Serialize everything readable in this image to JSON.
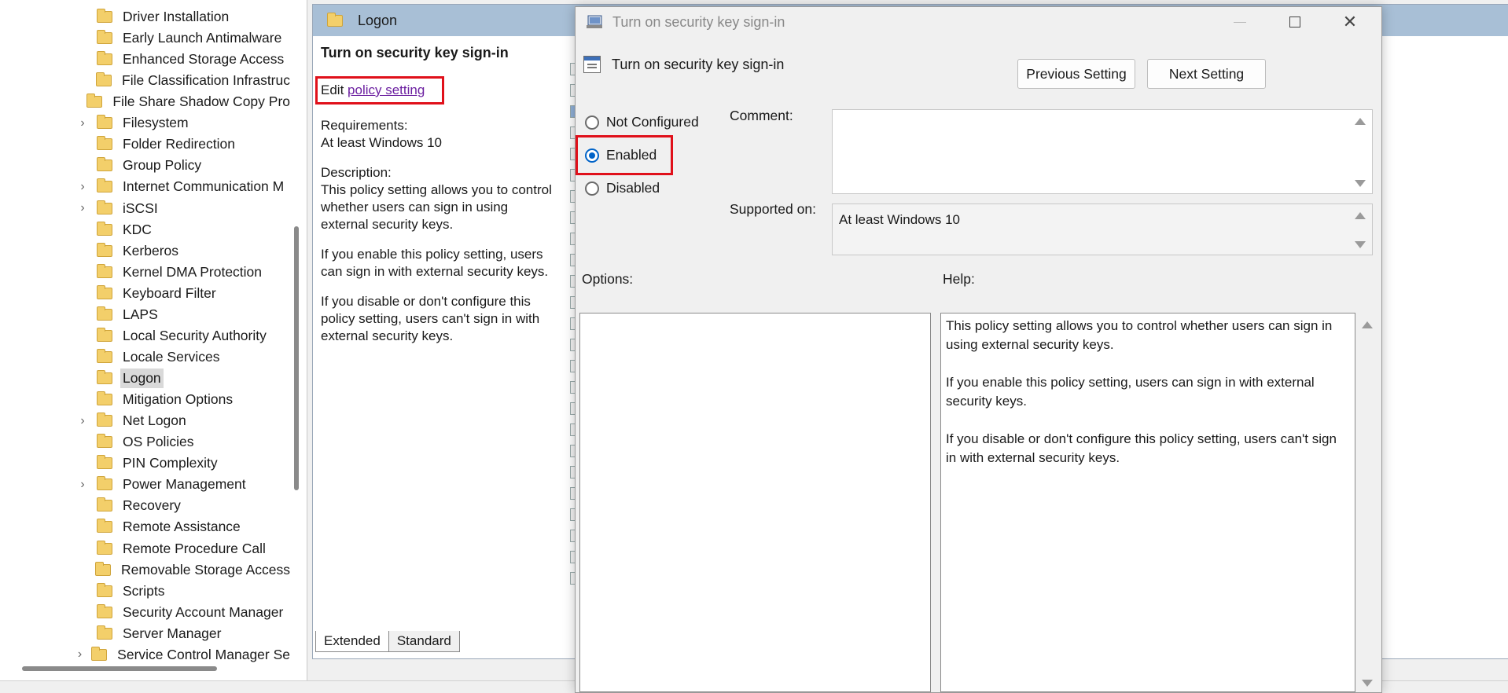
{
  "tree": {
    "items": [
      {
        "label": "Driver Installation",
        "expandable": false
      },
      {
        "label": "Early Launch Antimalware",
        "expandable": false
      },
      {
        "label": "Enhanced Storage Access",
        "expandable": false
      },
      {
        "label": "File Classification Infrastruc",
        "expandable": false
      },
      {
        "label": "File Share Shadow Copy Pro",
        "expandable": false
      },
      {
        "label": "Filesystem",
        "expandable": true
      },
      {
        "label": "Folder Redirection",
        "expandable": false
      },
      {
        "label": "Group Policy",
        "expandable": false
      },
      {
        "label": "Internet Communication M",
        "expandable": true
      },
      {
        "label": "iSCSI",
        "expandable": true
      },
      {
        "label": "KDC",
        "expandable": false
      },
      {
        "label": "Kerberos",
        "expandable": false
      },
      {
        "label": "Kernel DMA Protection",
        "expandable": false
      },
      {
        "label": "Keyboard Filter",
        "expandable": false
      },
      {
        "label": "LAPS",
        "expandable": false
      },
      {
        "label": "Local Security Authority",
        "expandable": false
      },
      {
        "label": "Locale Services",
        "expandable": false
      },
      {
        "label": "Logon",
        "expandable": false,
        "selected": true
      },
      {
        "label": "Mitigation Options",
        "expandable": false
      },
      {
        "label": "Net Logon",
        "expandable": true
      },
      {
        "label": "OS Policies",
        "expandable": false
      },
      {
        "label": "PIN Complexity",
        "expandable": false
      },
      {
        "label": "Power Management",
        "expandable": true
      },
      {
        "label": "Recovery",
        "expandable": false
      },
      {
        "label": "Remote Assistance",
        "expandable": false
      },
      {
        "label": "Remote Procedure Call",
        "expandable": false
      },
      {
        "label": "Removable Storage Access",
        "expandable": false
      },
      {
        "label": "Scripts",
        "expandable": false
      },
      {
        "label": "Security Account Manager",
        "expandable": false
      },
      {
        "label": "Server Manager",
        "expandable": false
      },
      {
        "label": "Service Control Manager Se",
        "expandable": true
      }
    ]
  },
  "detail": {
    "header_title": "Logon",
    "policy_title": "Turn on security key sign-in",
    "edit_prefix": "Edit",
    "edit_link": "policy setting",
    "requirements_label": "Requirements:",
    "requirements_value": "At least Windows 10",
    "description_label": "Description:",
    "description_p1": "This policy setting allows you to control whether users can sign in using external security keys.",
    "description_p2": "If you enable this policy setting, users can sign in with external security keys.",
    "description_p3": "If you disable or don't configure this policy setting, users can't sign in with external security keys.",
    "tabs": [
      "Extended",
      "Standard"
    ]
  },
  "dialog": {
    "window_title": "Turn on security key sign-in",
    "heading": "Turn on security key sign-in",
    "previous_label": "Previous Setting",
    "next_label": "Next Setting",
    "radios": {
      "not_configured": "Not Configured",
      "enabled": "Enabled",
      "disabled": "Disabled",
      "selected": "enabled"
    },
    "comment_label": "Comment:",
    "comment_value": "",
    "supported_label": "Supported on:",
    "supported_value": "At least Windows 10",
    "options_label": "Options:",
    "help_label": "Help:",
    "help_p1": "This policy setting allows you to control whether users can sign in using external security keys.",
    "help_p2": "If you enable this policy setting, users can sign in with external security keys.",
    "help_p3": "If you disable or don't configure this policy setting, users can't sign in with external security keys."
  },
  "colors": {
    "highlight_red": "#e0101a",
    "radio_blue": "#0063c8",
    "header_blue": "#a8bfd6",
    "link_purple": "#6b1fa0"
  }
}
